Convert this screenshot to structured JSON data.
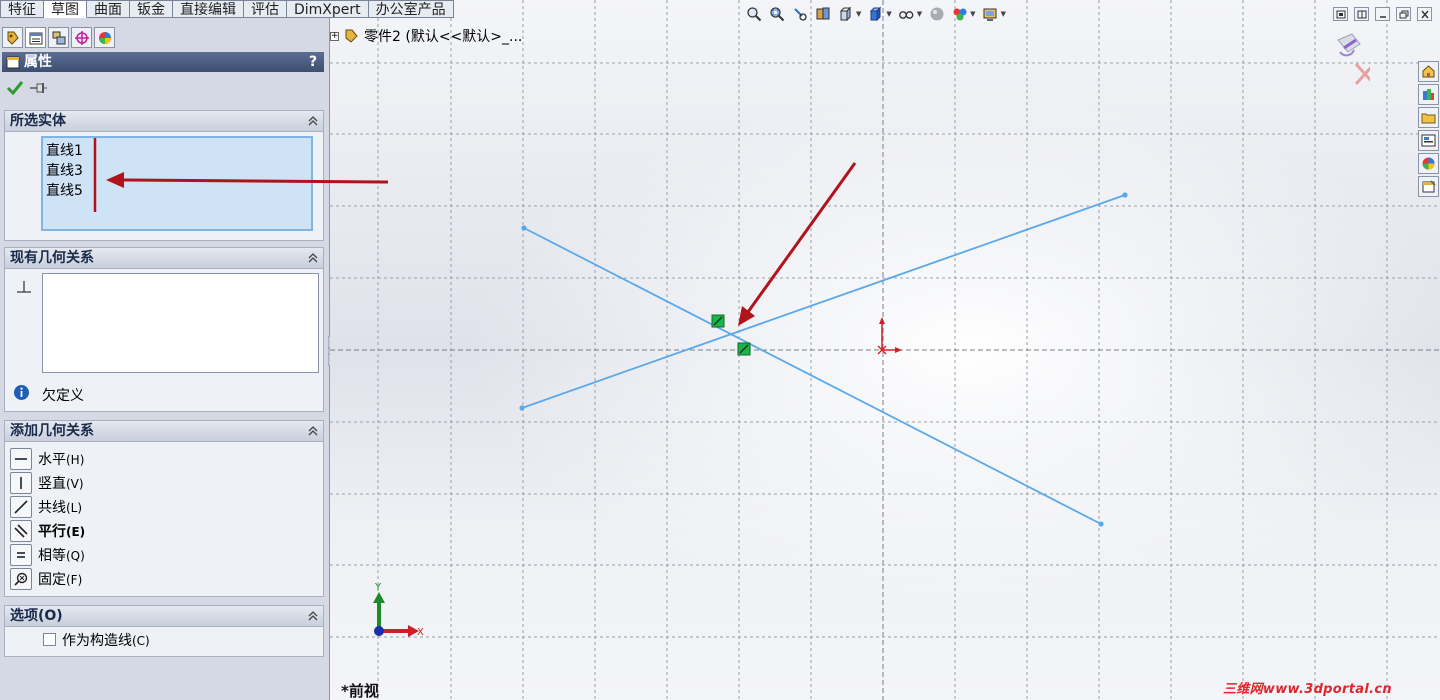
{
  "command_tabs": [
    "特征",
    "草图",
    "曲面",
    "钣金",
    "直接编辑",
    "评估",
    "DimXpert",
    "办公室产品"
  ],
  "active_command_tab": 1,
  "manager_tabs": [
    {
      "icon": "feature-manager-icon"
    },
    {
      "icon": "property-manager-icon"
    },
    {
      "icon": "configuration-manager-icon"
    },
    {
      "icon": "dimxpert-manager-icon"
    },
    {
      "icon": "display-manager-icon"
    }
  ],
  "property_manager": {
    "title": "属性",
    "help": "?"
  },
  "selected_entities": {
    "title": "所选实体",
    "items": [
      "直线1",
      "直线3",
      "直线5"
    ]
  },
  "existing_relations": {
    "title": "现有几何关系",
    "status": "欠定义"
  },
  "add_relations": {
    "title": "添加几何关系",
    "items": [
      {
        "label": "水平",
        "accel": "(H)",
        "icon": "horizontal-icon"
      },
      {
        "label": "竖直",
        "accel": "(V)",
        "icon": "vertical-icon"
      },
      {
        "label": "共线",
        "accel": "(L)",
        "icon": "collinear-icon"
      },
      {
        "label": "平行",
        "accel": "(E)",
        "icon": "parallel-icon",
        "bold": true
      },
      {
        "label": "相等",
        "accel": "(Q)",
        "icon": "equal-icon"
      },
      {
        "label": "固定",
        "accel": "(F)",
        "icon": "fix-icon"
      }
    ]
  },
  "options": {
    "title": "选项(O)",
    "construction": {
      "label": "作为构造线",
      "accel": "(C)",
      "checked": false
    }
  },
  "canvas": {
    "tree_node": "零件2  (默认<<默认>_...",
    "view_name": "*前视",
    "triad": {
      "x": "X",
      "y": "Y"
    },
    "watermark": "三维网www.3dportal.cn"
  },
  "colors": {
    "sketch_line": "#5aa9ec",
    "arrow": "#b0141a",
    "relation_marker": "#1bb34a",
    "origin": "#d0202a"
  }
}
